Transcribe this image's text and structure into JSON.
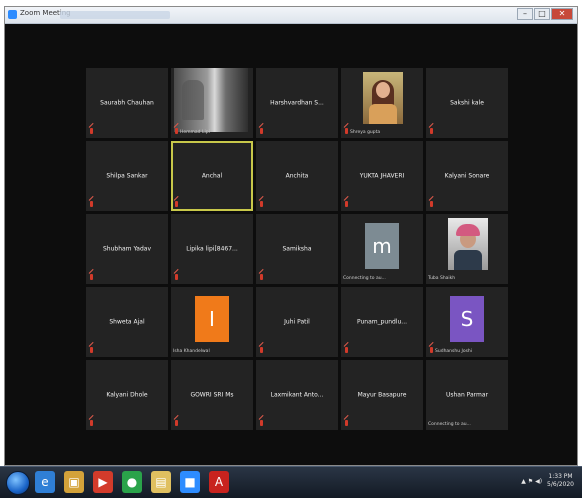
{
  "window": {
    "title": "Zoom Meeting",
    "controls": {
      "minimize": "–",
      "maximize": "□",
      "close": "✕"
    }
  },
  "participants": [
    {
      "name": "Saurabh Chauhan",
      "caption": "",
      "type": "name",
      "muted": true,
      "active": false
    },
    {
      "name": "",
      "caption": "Hemmad Lipi",
      "type": "video",
      "muted": true,
      "active": false
    },
    {
      "name": "Harshvardhan S...",
      "caption": "",
      "type": "name",
      "muted": true,
      "active": false
    },
    {
      "name": "",
      "caption": "Shreya gupta",
      "type": "photo",
      "muted": true,
      "active": false
    },
    {
      "name": "Sakshi kale",
      "caption": "",
      "type": "name",
      "muted": true,
      "active": false
    },
    {
      "name": "Shilpa Sankar",
      "caption": "",
      "type": "name",
      "muted": true,
      "active": false
    },
    {
      "name": "Anchal",
      "caption": "",
      "type": "name",
      "muted": true,
      "active": true
    },
    {
      "name": "Anchita",
      "caption": "",
      "type": "name",
      "muted": true,
      "active": false
    },
    {
      "name": "YUKTA JHAVERI",
      "caption": "",
      "type": "name",
      "muted": true,
      "active": false
    },
    {
      "name": "Kalyani Sonare",
      "caption": "",
      "type": "name",
      "muted": true,
      "active": false
    },
    {
      "name": "Shubham Yadav",
      "caption": "",
      "type": "name",
      "muted": true,
      "active": false
    },
    {
      "name": "Lipika lipi[8467...",
      "caption": "",
      "type": "name",
      "muted": true,
      "active": false
    },
    {
      "name": "Samiksha",
      "caption": "",
      "type": "name",
      "muted": true,
      "active": false
    },
    {
      "name": "",
      "caption": "Connecting to au...",
      "type": "letter",
      "letter": "m",
      "color": "#7d8b93",
      "muted": false,
      "active": false
    },
    {
      "name": "",
      "caption": "Tuba Shaikh",
      "type": "photo2",
      "muted": false,
      "active": false
    },
    {
      "name": "Shweta Ajal",
      "caption": "",
      "type": "name",
      "muted": true,
      "active": false
    },
    {
      "name": "",
      "caption": "Isha Khandelwal",
      "type": "letter",
      "letter": "I",
      "color": "#f07a1a",
      "muted": false,
      "active": false
    },
    {
      "name": "Juhi Patil",
      "caption": "",
      "type": "name",
      "muted": true,
      "active": false
    },
    {
      "name": "Punam_pundlu...",
      "caption": "",
      "type": "name",
      "muted": true,
      "active": false
    },
    {
      "name": "",
      "caption": "Sudhanshu Joshi",
      "type": "letter",
      "letter": "S",
      "color": "#7a55c2",
      "muted": true,
      "active": false
    },
    {
      "name": "Kalyani Dhole",
      "caption": "",
      "type": "name",
      "muted": true,
      "active": false
    },
    {
      "name": "GOWRI SRI Ms",
      "caption": "",
      "type": "name",
      "muted": true,
      "active": false
    },
    {
      "name": "Laxmikant Anto...",
      "caption": "",
      "type": "name",
      "muted": true,
      "active": false
    },
    {
      "name": "Mayur Basapure",
      "caption": "",
      "type": "name",
      "muted": true,
      "active": false
    },
    {
      "name": "Ushan Parmar",
      "caption": "Connecting to au...",
      "type": "name",
      "muted": false,
      "active": false
    }
  ],
  "taskbar": {
    "icons": [
      {
        "name": "ie-icon",
        "glyph": "e",
        "color": "#2f7fd6"
      },
      {
        "name": "explorer-icon",
        "glyph": "▣",
        "color": "#d3a23a"
      },
      {
        "name": "media-icon",
        "glyph": "▶",
        "color": "#d33b2b"
      },
      {
        "name": "chrome-icon",
        "glyph": "●",
        "color": "#2aa34a"
      },
      {
        "name": "folder-icon",
        "glyph": "▤",
        "color": "#e0c060"
      },
      {
        "name": "zoom-icon",
        "glyph": "■",
        "color": "#2d8cff"
      },
      {
        "name": "acrobat-icon",
        "glyph": "A",
        "color": "#c8231e"
      }
    ],
    "clock_time": "1:33 PM",
    "clock_date": "5/6/2020",
    "tray_text": "▲ ⚑ ◀)"
  }
}
